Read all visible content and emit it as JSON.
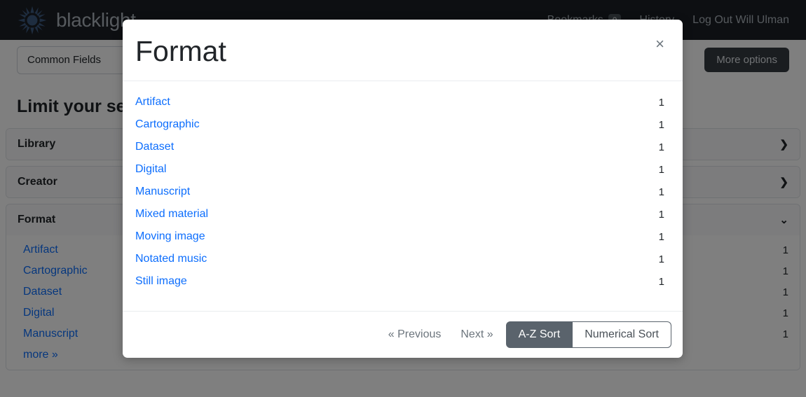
{
  "navbar": {
    "brand": "blacklight",
    "logo_icon": "sun-starburst-icon",
    "bookmarks_label": "Bookmarks",
    "bookmarks_count": "0",
    "history_label": "History",
    "logout_label": "Log Out Will Ulman"
  },
  "search": {
    "field_selector": "Common Fields",
    "more_options_label": "More options"
  },
  "sidebar": {
    "heading": "Limit your search",
    "facets": [
      {
        "label": "Library",
        "expanded": false,
        "chevron": "chevron-right-icon",
        "items": []
      },
      {
        "label": "Creator",
        "expanded": false,
        "chevron": "chevron-right-icon",
        "items": []
      },
      {
        "label": "Format",
        "expanded": true,
        "chevron": "chevron-down-icon",
        "items": [
          {
            "label": "Artifact",
            "count": "1"
          },
          {
            "label": "Cartographic",
            "count": "1"
          },
          {
            "label": "Dataset",
            "count": "1"
          },
          {
            "label": "Digital",
            "count": "1"
          },
          {
            "label": "Manuscript",
            "count": "1"
          }
        ],
        "more_label": "more »"
      }
    ]
  },
  "modal": {
    "title": "Format",
    "close_icon": "×",
    "items": [
      {
        "label": "Artifact",
        "count": "1"
      },
      {
        "label": "Cartographic",
        "count": "1"
      },
      {
        "label": "Dataset",
        "count": "1"
      },
      {
        "label": "Digital",
        "count": "1"
      },
      {
        "label": "Manuscript",
        "count": "1"
      },
      {
        "label": "Mixed material",
        "count": "1"
      },
      {
        "label": "Moving image",
        "count": "1"
      },
      {
        "label": "Notated music",
        "count": "1"
      },
      {
        "label": "Still image",
        "count": "1"
      }
    ],
    "footer": {
      "previous_label": "« Previous",
      "next_label": "Next »",
      "az_sort_label": "A-Z Sort",
      "numerical_sort_label": "Numerical Sort",
      "active_sort": "A-Z Sort"
    }
  },
  "colors": {
    "navbar_bg": "#1b1f24",
    "link_blue": "#0d6efd",
    "button_dark": "#343a40",
    "sort_active": "#5a636c",
    "backdrop": "rgba(0,0,0,0.5)"
  }
}
